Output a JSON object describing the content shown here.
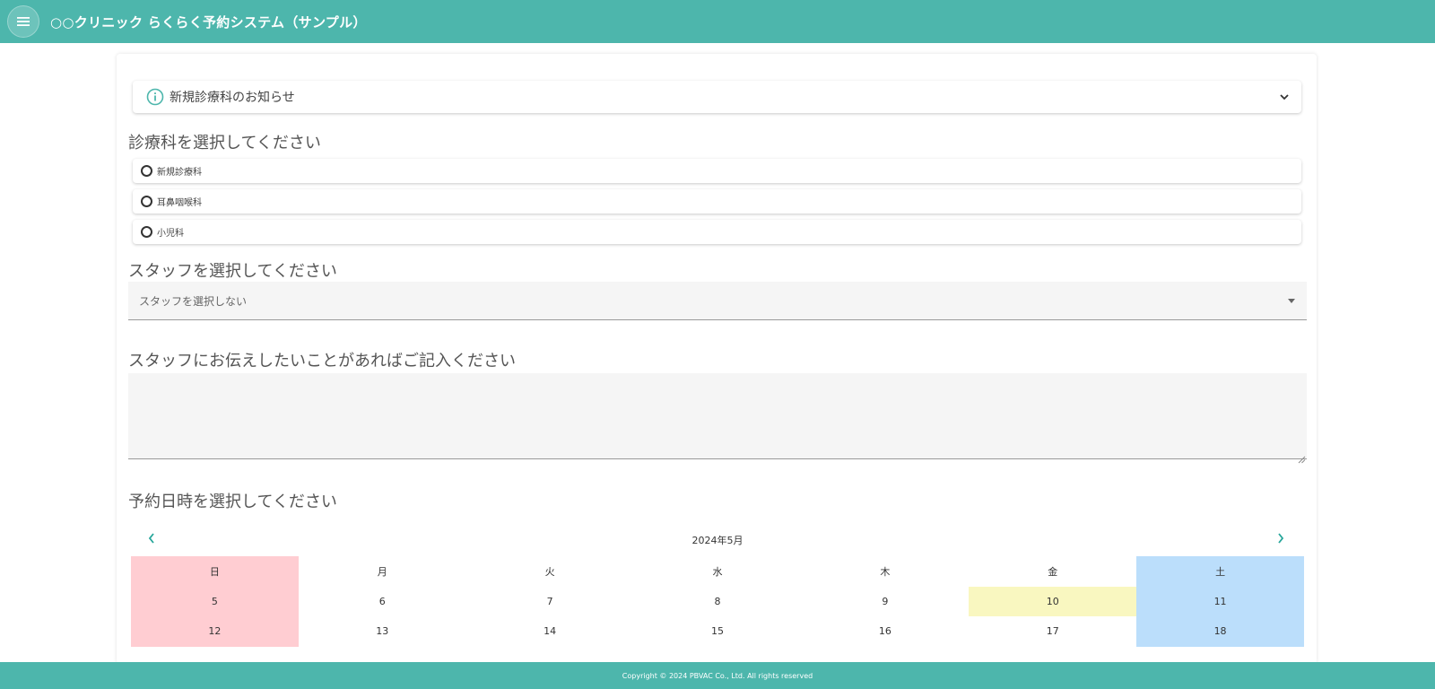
{
  "app": {
    "title": "○○クリニック らくらく予約システム（サンプル）",
    "accent_color": "#4db6ac"
  },
  "notice": {
    "label": "新規診療科のお知らせ",
    "icon": "info-icon"
  },
  "department": {
    "heading": "診療科を選択してください",
    "options": [
      {
        "label": "新規診療科",
        "selected": false
      },
      {
        "label": "耳鼻咽喉科",
        "selected": false
      },
      {
        "label": "小児科",
        "selected": false
      }
    ]
  },
  "staff": {
    "heading": "スタッフを選択してください",
    "selected": "スタッフを選択しない"
  },
  "message": {
    "heading": "スタッフにお伝えしたいことがあればご記入ください",
    "value": ""
  },
  "datetime": {
    "heading": "予約日時を選択してください"
  },
  "calendar": {
    "month": "2024年5月",
    "weekdays": [
      "日",
      "月",
      "火",
      "水",
      "木",
      "金",
      "土"
    ],
    "weeks": [
      [
        "5",
        "6",
        "7",
        "8",
        "9",
        "10",
        "11"
      ],
      [
        "12",
        "13",
        "14",
        "15",
        "16",
        "17",
        "18"
      ]
    ],
    "highlighted_day": "10",
    "colors": {
      "sunday": "#ffcdd2",
      "saturday": "#bbdefb",
      "highlight": "#f9f7c0"
    }
  },
  "footer": {
    "copyright": "Copyright © 2024 PBVAC Co., Ltd. All rights reserved"
  }
}
